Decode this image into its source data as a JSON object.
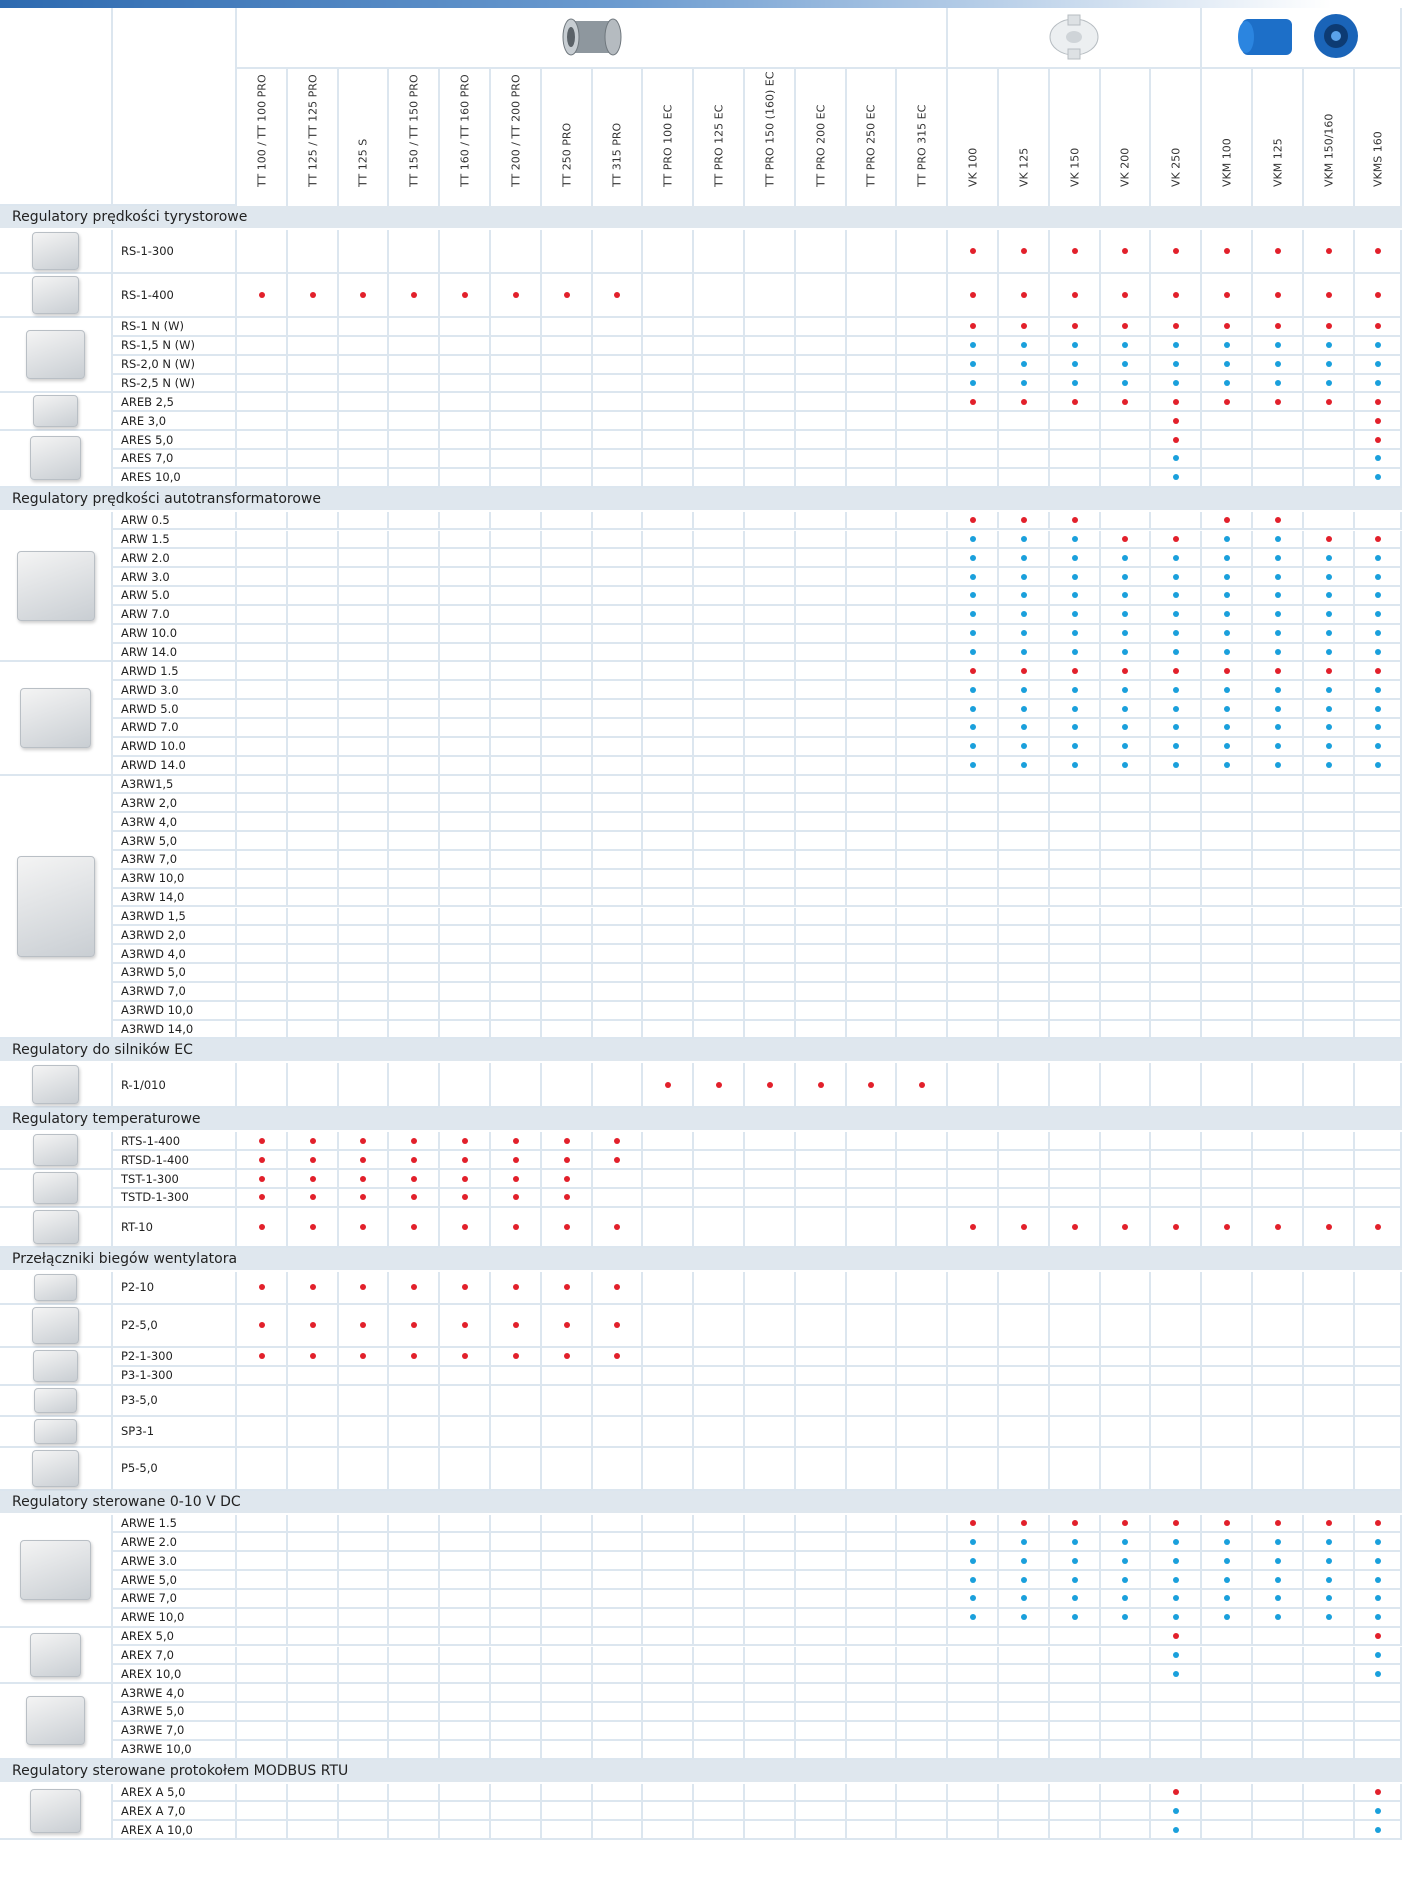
{
  "header": {
    "fan_icons": [
      "inline-fan-icon",
      "radial-duct-fan-icon",
      "blue-metal-fan-icon"
    ]
  },
  "columns": [
    "TT 100 / TT 100 PRO",
    "TT 125 / TT 125 PRO",
    "TT 125 S",
    "TT 150 / TT 150 PRO",
    "TT 160 / TT 160 PRO",
    "TT 200 / TT 200 PRO",
    "TT 250 PRO",
    "TT 315 PRO",
    "TT PRO 100 EC",
    "TT PRO 125 EC",
    "TT PRO 150 (160) EC",
    "TT PRO 200 EC",
    "TT PRO 250 EC",
    "TT PRO 315 EC",
    "VK 100",
    "VK 125",
    "VK 150",
    "VK 200",
    "VK 250",
    "VKM 100",
    "VKM 125",
    "VKM 150/160",
    "VKMS 160"
  ],
  "colors": {
    "red": "#e2202b",
    "blue": "#1aa0dc"
  },
  "sections": [
    {
      "title": "Regulatory prędkości tyrystorowe",
      "groups": [
        {
          "icon": "dial-regulator-icon",
          "rows": [
            {
              "label": "RS-1-300",
              "v": "..............rrrrrrrrr"
            }
          ]
        },
        {
          "icon": "dial-regulator-icon",
          "rows": [
            {
              "label": "RS-1-400",
              "v": "rrrrrrrr......rrrrrrrrr"
            }
          ]
        },
        {
          "icon": "box-regulator-icon",
          "rows": [
            {
              "label": "RS-1 N (W)",
              "v": "..............rrrrrrrrr"
            },
            {
              "label": "RS-1,5 N (W)",
              "v": "..............bbbbbbbbb"
            },
            {
              "label": "RS-2,0 N (W)",
              "v": "..............bbbbbbbbb"
            },
            {
              "label": "RS-2,5 N (W)",
              "v": "..............bbbbbbbbb"
            }
          ]
        },
        {
          "icon": "dial-regulator-icon",
          "rows": [
            {
              "label": "AREB 2,5",
              "v": "..............rrrrrrrrr"
            },
            {
              "label": "ARE 3,0",
              "v": "..................r...r"
            }
          ]
        },
        {
          "icon": "din-regulator-icon",
          "rows": [
            {
              "label": "ARES 5,0",
              "v": "..................r...r"
            },
            {
              "label": "ARES 7,0",
              "v": "..................b...b"
            },
            {
              "label": "ARES 10,0",
              "v": "..................b...b"
            }
          ]
        }
      ]
    },
    {
      "title": "Regulatory prędkości autotransformatorowe",
      "groups": [
        {
          "icon": "transformer-box-icon",
          "rows": [
            {
              "label": "ARW 0.5",
              "v": "..............rrr..rr.."
            },
            {
              "label": "ARW 1.5",
              "v": "..............bbbrrbbrr"
            },
            {
              "label": "ARW 2.0",
              "v": "..............bbbbbbbbb"
            },
            {
              "label": "ARW 3.0",
              "v": "..............bbbbbbbbb"
            },
            {
              "label": "ARW 5.0",
              "v": "..............bbbbbbbbb"
            },
            {
              "label": "ARW 7.0",
              "v": "..............bbbbbbbbb"
            },
            {
              "label": "ARW 10.0",
              "v": "..............bbbbbbbbb"
            },
            {
              "label": "ARW 14.0",
              "v": "..............bbbbbbbbb"
            }
          ]
        },
        {
          "icon": "transformer-box-icon",
          "rows": [
            {
              "label": "ARWD 1.5",
              "v": "..............rrrrrrrrr"
            },
            {
              "label": "ARWD 3.0",
              "v": "..............bbbbbbbbb"
            },
            {
              "label": "ARWD 5.0",
              "v": "..............bbbbbbbbb"
            },
            {
              "label": "ARWD 7.0",
              "v": "..............bbbbbbbbb"
            },
            {
              "label": "ARWD 10.0",
              "v": "..............bbbbbbbbb"
            },
            {
              "label": "ARWD 14.0",
              "v": "..............bbbbbbbbb"
            }
          ]
        },
        {
          "icon": "three-phase-transformer-icon",
          "rows": [
            {
              "label": "A3RW1,5",
              "v": ""
            },
            {
              "label": "A3RW 2,0",
              "v": ""
            },
            {
              "label": "A3RW 4,0",
              "v": ""
            },
            {
              "label": "A3RW 5,0",
              "v": ""
            },
            {
              "label": "A3RW 7,0",
              "v": ""
            },
            {
              "label": "A3RW 10,0",
              "v": ""
            },
            {
              "label": "A3RW 14,0",
              "v": ""
            },
            {
              "label": "A3RWD 1,5",
              "v": ""
            },
            {
              "label": "A3RWD 2,0",
              "v": ""
            },
            {
              "label": "A3RWD 4,0",
              "v": ""
            },
            {
              "label": "A3RWD 5,0",
              "v": ""
            },
            {
              "label": "A3RWD 7,0",
              "v": ""
            },
            {
              "label": "A3RWD 10,0",
              "v": ""
            },
            {
              "label": "A3RWD 14,0",
              "v": ""
            }
          ]
        }
      ]
    },
    {
      "title": "Regulatory do silników EC",
      "groups": [
        {
          "icon": "ec-dial-regulator-icon",
          "rows": [
            {
              "label": "R-1/010",
              "v": "........rrrrrr"
            }
          ]
        }
      ]
    },
    {
      "title": "Regulatory temperaturowe",
      "groups": [
        {
          "icon": "thermostat-remote-icon",
          "rows": [
            {
              "label": "RTS-1-400",
              "v": "rrrrrrrr"
            },
            {
              "label": "RTSD-1-400",
              "v": "rrrrrrrr"
            }
          ]
        },
        {
          "icon": "thermostat-display-icon",
          "rows": [
            {
              "label": "TST-1-300",
              "v": "rrrrrrr"
            },
            {
              "label": "TSTD-1-300",
              "v": "rrrrrrr"
            }
          ]
        },
        {
          "icon": "thermostat-dial-icon",
          "rows": [
            {
              "label": "RT-10",
              "v": "rrrrrrrr......rrrrrrrrr"
            }
          ]
        }
      ]
    },
    {
      "title": "Przełączniki biegów wentylatora",
      "groups": [
        {
          "icon": "wall-switch-icon",
          "rows": [
            {
              "label": "P2-10",
              "v": "rrrrrrrr"
            }
          ]
        },
        {
          "icon": "switch-box-icon",
          "rows": [
            {
              "label": "P2-5,0",
              "v": "rrrrrrrr"
            }
          ]
        },
        {
          "icon": "wall-switch-icon",
          "rows": [
            {
              "label": "P2-1-300",
              "v": "rrrrrrrr"
            },
            {
              "label": "P3-1-300",
              "v": ""
            }
          ]
        },
        {
          "icon": "wall-switch-icon",
          "rows": [
            {
              "label": "P3-5,0",
              "v": ""
            }
          ]
        },
        {
          "icon": "wall-switch-icon",
          "rows": [
            {
              "label": "SP3-1",
              "v": ""
            }
          ]
        },
        {
          "icon": "switch-box-icon",
          "rows": [
            {
              "label": "P5-5,0",
              "v": ""
            }
          ]
        }
      ]
    },
    {
      "title": "Regulatory sterowane 0-10 V DC",
      "groups": [
        {
          "icon": "din-regulator-icon",
          "rows": [
            {
              "label": "ARWE 1.5",
              "v": "..............rrrrrrrrr"
            },
            {
              "label": "ARWE 2.0",
              "v": "..............bbbbbbbbb"
            },
            {
              "label": "ARWE 3.0",
              "v": "..............bbbbbbbbb"
            },
            {
              "label": "ARWE 5,0",
              "v": "..............bbbbbbbbb"
            },
            {
              "label": "ARWE 7,0",
              "v": "..............bbbbbbbbb"
            },
            {
              "label": "ARWE 10,0",
              "v": "..............bbbbbbbbb"
            }
          ]
        },
        {
          "icon": "din-regulator-icon",
          "rows": [
            {
              "label": "AREX 5,0",
              "v": "..................r...r"
            },
            {
              "label": "AREX 7,0",
              "v": "..................b...b"
            },
            {
              "label": "AREX 10,0",
              "v": "..................b...b"
            }
          ]
        },
        {
          "icon": "three-phase-transformer-icon",
          "rows": [
            {
              "label": "A3RWE 4,0",
              "v": ""
            },
            {
              "label": "A3RWE 5,0",
              "v": ""
            },
            {
              "label": "A3RWE 7,0",
              "v": ""
            },
            {
              "label": "A3RWE 10,0",
              "v": ""
            }
          ]
        }
      ]
    },
    {
      "title": "Regulatory sterowane protokołem MODBUS RTU",
      "groups": [
        {
          "icon": "din-regulator-icon",
          "rows": [
            {
              "label": "AREX A 5,0",
              "v": "..................r...r"
            },
            {
              "label": "AREX A 7,0",
              "v": "..................b...b"
            },
            {
              "label": "AREX A 10,0",
              "v": "..................b...b"
            }
          ]
        }
      ]
    }
  ]
}
